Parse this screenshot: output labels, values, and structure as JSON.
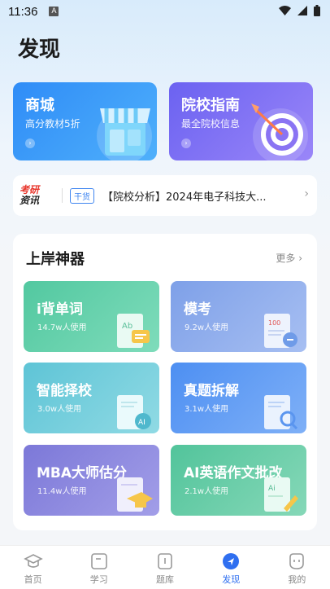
{
  "status": {
    "time": "11:36",
    "notif": "A"
  },
  "page": {
    "title": "发现"
  },
  "promos": [
    {
      "title": "商城",
      "subtitle": "高分教材5折",
      "arrow": "›"
    },
    {
      "title": "院校指南",
      "subtitle": "最全院校信息",
      "arrow": "›"
    }
  ],
  "news": {
    "logo_top": "考研",
    "logo_bottom": "资讯",
    "tag": "干货",
    "text": "【院校分析】2024年电子科技大...",
    "chevron": "›"
  },
  "tools": {
    "title": "上岸神器",
    "more": "更多 ›",
    "items": [
      {
        "title": "i背单词",
        "usage": "14.7w人使用",
        "color_from": "#52c8a0",
        "color_to": "#7fdcbb"
      },
      {
        "title": "模考",
        "usage": "9.2w人使用",
        "color_from": "#7ea0e8",
        "color_to": "#a7bff2"
      },
      {
        "title": "智能择校",
        "usage": "3.0w人使用",
        "color_from": "#5ec4d6",
        "color_to": "#90dae4"
      },
      {
        "title": "真题拆解",
        "usage": "3.1w人使用",
        "color_from": "#4d8ff2",
        "color_to": "#7fb0f7"
      },
      {
        "title": "MBA大师估分",
        "usage": "11.4w人使用",
        "color_from": "#7c78d8",
        "color_to": "#a29ee8"
      },
      {
        "title": "AI英语作文批改",
        "usage": "2.1w人使用",
        "color_from": "#52c49b",
        "color_to": "#86d8b8"
      }
    ]
  },
  "tabs": [
    {
      "label": "首页",
      "icon": "graduation-cap-icon",
      "active": false
    },
    {
      "label": "学习",
      "icon": "study-icon",
      "active": false
    },
    {
      "label": "题库",
      "icon": "question-bank-icon",
      "active": false
    },
    {
      "label": "发现",
      "icon": "discover-icon",
      "active": true
    },
    {
      "label": "我的",
      "icon": "profile-icon",
      "active": false
    }
  ],
  "colors": {
    "accent": "#2f6ff0",
    "mall": "#2f8cf7",
    "guide": "#6b62f1"
  }
}
